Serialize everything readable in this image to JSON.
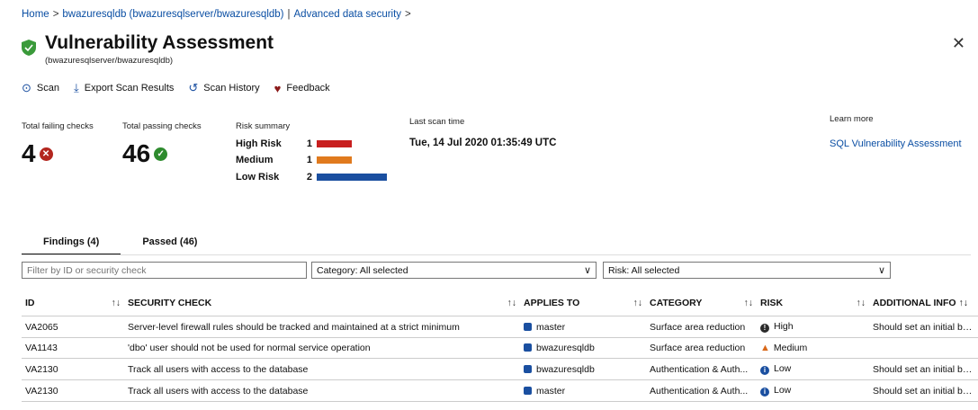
{
  "breadcrumb": {
    "home": "Home",
    "sep": ">",
    "db": "bwazuresqldb (bwazuresqlserver/bwazuresqldb)",
    "pipe": "|",
    "section": "Advanced data security",
    "sep2": ">"
  },
  "header": {
    "title": "Vulnerability Assessment",
    "subtitle": "(bwazuresqlserver/bwazuresqldb)",
    "close": "✕"
  },
  "toolbar": {
    "scan": "Scan",
    "export": "Export Scan Results",
    "history": "Scan History",
    "feedback": "Feedback"
  },
  "summary": {
    "failing_label": "Total failing checks",
    "failing_count": "4",
    "passing_label": "Total passing checks",
    "passing_count": "46",
    "risk_label": "Risk summary",
    "risks": [
      {
        "name": "High Risk",
        "count": "1",
        "value": 1,
        "color": "#c81f1f"
      },
      {
        "name": "Medium",
        "count": "1",
        "value": 1,
        "color": "#e07a1e"
      },
      {
        "name": "Low Risk",
        "count": "2",
        "value": 2,
        "color": "#1a4fa0"
      }
    ],
    "last_scan_label": "Last scan time",
    "last_scan_value": "Tue, 14 Jul 2020 01:35:49 UTC",
    "learn_label": "Learn more",
    "learn_link": "SQL Vulnerability Assessment"
  },
  "tabs": {
    "findings": "Findings (4)",
    "passed": "Passed (46)"
  },
  "filters": {
    "search_placeholder": "Filter by ID or security check",
    "category": "Category: All selected",
    "risk": "Risk: All selected"
  },
  "table": {
    "headers": [
      "ID",
      "SECURITY CHECK",
      "APPLIES TO",
      "CATEGORY",
      "RISK",
      "ADDITIONAL INFO"
    ],
    "sort_glyph": "↑↓",
    "rows": [
      {
        "id": "VA2065",
        "check": "Server-level firewall rules should be tracked and maintained at a strict minimum",
        "applies": "master",
        "category": "Surface area reduction",
        "risk": "High",
        "info": "Should set an initial ba..."
      },
      {
        "id": "VA1143",
        "check": "'dbo' user should not be used for normal service operation",
        "applies": "bwazuresqldb",
        "category": "Surface area reduction",
        "risk": "Medium",
        "info": ""
      },
      {
        "id": "VA2130",
        "check": "Track all users with access to the database",
        "applies": "bwazuresqldb",
        "category": "Authentication & Auth...",
        "risk": "Low",
        "info": "Should set an initial ba..."
      },
      {
        "id": "VA2130",
        "check": "Track all users with access to the database",
        "applies": "master",
        "category": "Authentication & Auth...",
        "risk": "Low",
        "info": "Should set an initial ba..."
      }
    ]
  },
  "colors": {
    "link": "#0a4ea3",
    "fail": "#b3261e",
    "pass": "#2e8b2e",
    "high": "#2b2b2b",
    "medium": "#d9681a",
    "low": "#1a4fa0"
  }
}
